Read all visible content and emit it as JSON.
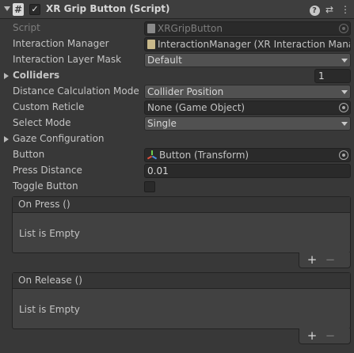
{
  "header": {
    "title": "XR Grip Button (Script)",
    "script_icon": "#",
    "enabled_check": "✓",
    "help_glyph": "?",
    "presets_glyph": "⇄",
    "menu_glyph": "⋮"
  },
  "properties": {
    "script": {
      "label": "Script",
      "value": "XRGripButton"
    },
    "interaction_manager": {
      "label": "Interaction Manager",
      "value": "InteractionManager (XR Interaction Mana"
    },
    "interaction_layer_mask": {
      "label": "Interaction Layer Mask",
      "value": "Default"
    },
    "colliders": {
      "label": "Colliders",
      "count": "1"
    },
    "distance_calc": {
      "label": "Distance Calculation Mode",
      "value": "Collider Position"
    },
    "custom_reticle": {
      "label": "Custom Reticle",
      "value": "None (Game Object)"
    },
    "select_mode": {
      "label": "Select Mode",
      "value": "Single"
    },
    "gaze_config": {
      "label": "Gaze Configuration"
    },
    "button": {
      "label": "Button",
      "value": "Button (Transform)"
    },
    "press_distance": {
      "label": "Press Distance",
      "value": "0.01"
    },
    "toggle_button": {
      "label": "Toggle Button",
      "checked": false
    }
  },
  "events": {
    "on_press": {
      "title": "On Press ()",
      "empty_text": "List is Empty"
    },
    "on_release": {
      "title": "On Release ()",
      "empty_text": "List is Empty"
    },
    "add_glyph": "+",
    "remove_glyph": "−"
  },
  "icons": {
    "script_asset": "script-asset-icon",
    "interaction_manager": "interaction-manager-icon",
    "transform": "transform-icon",
    "object_picker": "object-picker-icon"
  },
  "colors": {
    "panel_bg": "#383838",
    "header_bg": "#3e3e3e",
    "field_bg": "#2a2a2a",
    "dropdown_bg": "#515151",
    "text": "#c4c4c4",
    "dim_text": "#7e7e7e"
  }
}
